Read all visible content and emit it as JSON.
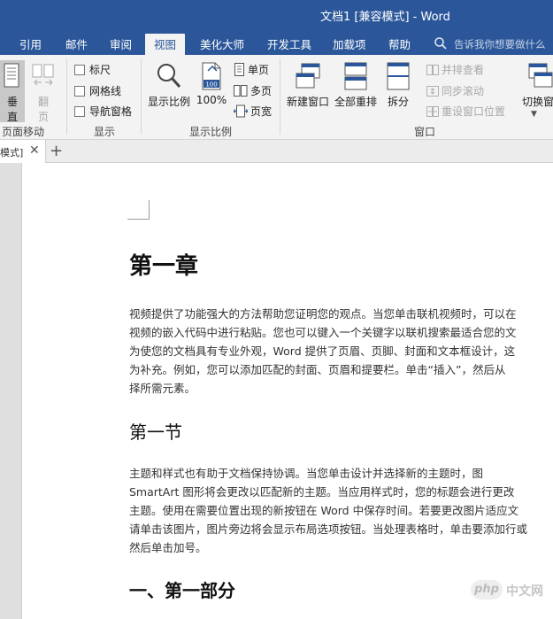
{
  "window": {
    "title": "文档1 [兼容模式] - Word"
  },
  "tabs": [
    {
      "label": "引用",
      "active": false
    },
    {
      "label": "邮件",
      "active": false
    },
    {
      "label": "审阅",
      "active": false
    },
    {
      "label": "视图",
      "active": true
    },
    {
      "label": "美化大师",
      "active": false
    },
    {
      "label": "开发工具",
      "active": false
    },
    {
      "label": "加载项",
      "active": false
    },
    {
      "label": "帮助",
      "active": false
    }
  ],
  "tell_me": {
    "placeholder": "告诉我你想要做什么"
  },
  "ribbon": {
    "page_movement": {
      "label": "页面移动",
      "vertical": "垂直",
      "side": "翻页"
    },
    "show": {
      "label": "显示",
      "ruler": "标尺",
      "gridlines": "网格线",
      "nav_pane": "导航窗格"
    },
    "zoom": {
      "label": "显示比例",
      "zoom_btn": "显示比例",
      "hundred": "100%",
      "hundred_icon": "100",
      "one_page": "单页",
      "multi_page": "多页",
      "page_width": "页宽"
    },
    "window": {
      "label": "窗口",
      "new_window": "新建窗口",
      "arrange_all": "全部重排",
      "split": "拆分",
      "side_by_side": "并排查看",
      "sync_scroll": "同步滚动",
      "reset_pos": "重设窗口位置",
      "switch": "切换窗"
    }
  },
  "doc_tab": {
    "label": "模式]"
  },
  "document": {
    "heading1": "第一章",
    "para1": [
      "视频提供了功能强大的方法帮助您证明您的观点。当您单击联机视频时，可以在",
      "视频的嵌入代码中进行粘贴。您也可以键入一个关键字以联机搜索最适合您的文",
      "为使您的文档具有专业外观，Word 提供了页眉、页脚、封面和文本框设计，这",
      "为补充。例如，您可以添加匹配的封面、页眉和提要栏。单击“插入”，然后从",
      "择所需元素。"
    ],
    "heading2": "第一节",
    "para2": [
      "主题和样式也有助于文档保持协调。当您单击设计并选择新的主题时，图",
      "SmartArt 图形将会更改以匹配新的主题。当应用样式时，您的标题会进行更改",
      "主题。使用在需要位置出现的新按钮在 Word 中保存时间。若要更改图片适应文",
      "请单击该图片，图片旁边将会显示布局选项按钮。当处理表格时，单击要添加行或",
      "然后单击加号。"
    ],
    "heading3": "一、第一部分"
  },
  "watermark": {
    "logo": "php",
    "site": "中文网"
  },
  "colors": {
    "brand": "#2b579a",
    "ribbon_bg": "#f3f3f3"
  }
}
